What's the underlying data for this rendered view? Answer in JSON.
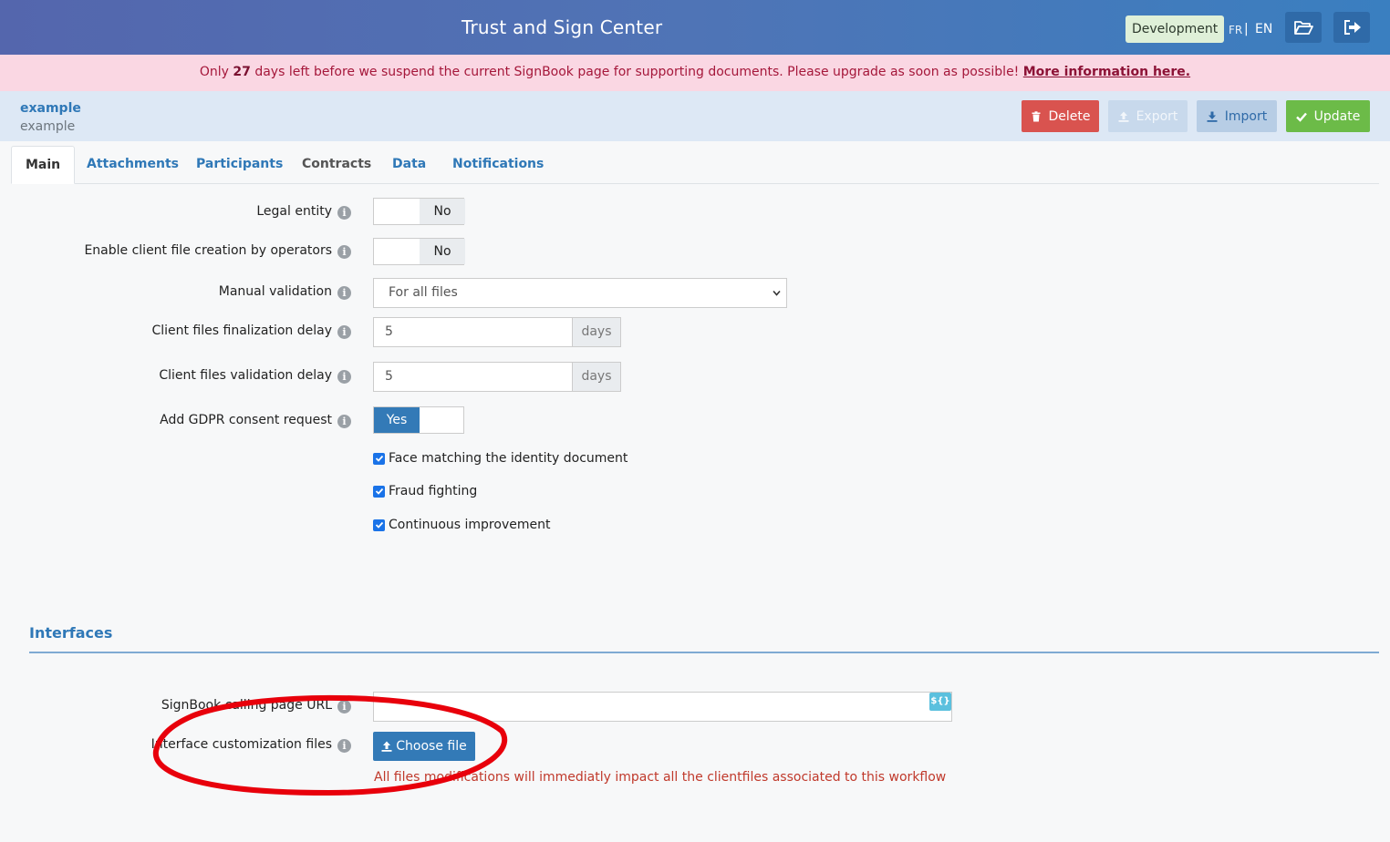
{
  "header": {
    "title": "Trust and Sign Center",
    "environment": "Development",
    "lang_fr": "FR",
    "lang_sep": "|",
    "lang_en": "EN",
    "icons": [
      "folder-open-icon",
      "sign-out-icon"
    ]
  },
  "notice": {
    "before": "Only ",
    "days": "27",
    "after": " days left before we suspend the current SignBook page for supporting documents. Please upgrade as soon as possible! ",
    "link": "More information here."
  },
  "record": {
    "name": "example",
    "subtitle": "example"
  },
  "actions": {
    "delete": "Delete",
    "export": "Export",
    "import": "Import",
    "update": "Update"
  },
  "tabs": [
    "Main",
    "Attachments",
    "Participants",
    "Contracts",
    "Data",
    "Notifications"
  ],
  "form": {
    "legal_entity": {
      "label": "Legal entity",
      "value": "No"
    },
    "client_file_creation": {
      "label": "Enable client file creation by operators",
      "value": "No"
    },
    "manual_validation": {
      "label": "Manual validation",
      "value": "For all files"
    },
    "finalization_delay": {
      "label": "Client files finalization delay",
      "value": "5",
      "unit": "days"
    },
    "validation_delay": {
      "label": "Client files validation delay",
      "value": "5",
      "unit": "days"
    },
    "gdpr": {
      "label": "Add GDPR consent request",
      "value": "Yes"
    },
    "checkboxes": [
      {
        "label": "Face matching the identity document",
        "checked": true
      },
      {
        "label": "Fraud fighting",
        "checked": true
      },
      {
        "label": "Continuous improvement",
        "checked": true
      }
    ],
    "info_glyph": "i"
  },
  "interfaces": {
    "title": "Interfaces",
    "calling_url_label": "SignBook calling page URL",
    "calling_url_value": "",
    "var_tag": "${}",
    "customization_label": "Interface customization files",
    "choose_file": "Choose file",
    "warning": "All files modifications will immediatly impact all the clientfiles associated to this workflow"
  },
  "colors": {
    "accent": "#337ab7",
    "delete": "#d9534f",
    "update": "#6cbb48",
    "annotation": "#e8000b"
  }
}
